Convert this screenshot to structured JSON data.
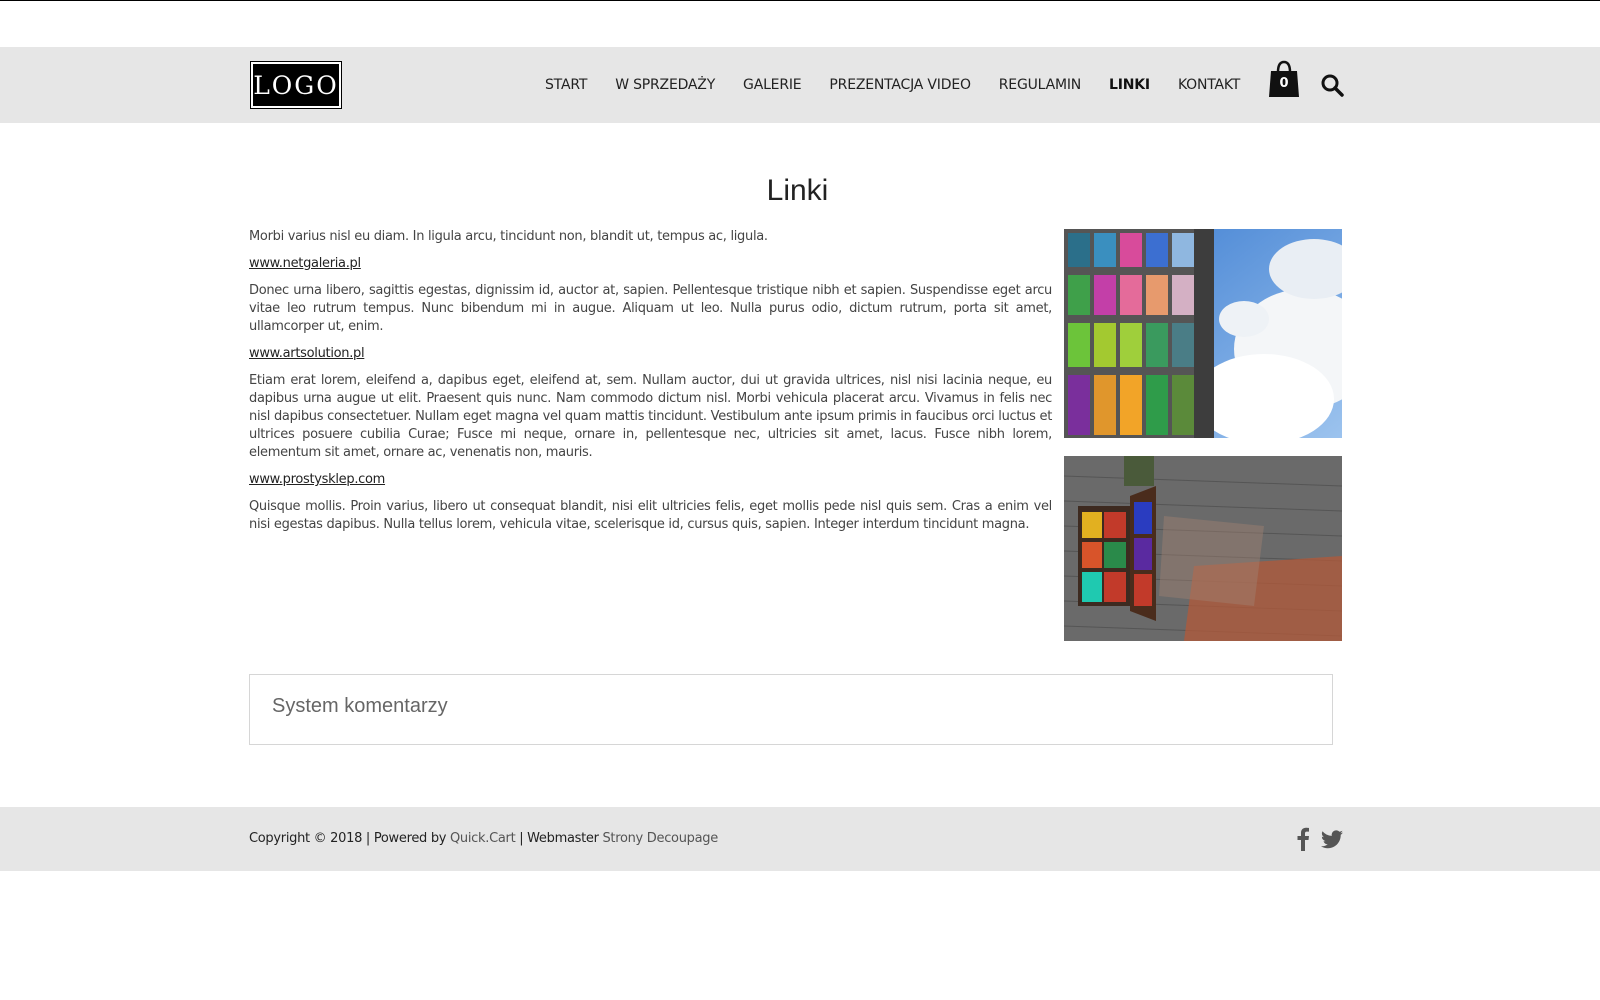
{
  "header": {
    "logo_text": "LOGO",
    "nav": [
      {
        "label": "START",
        "active": false
      },
      {
        "label": "W SPRZEDAŻY",
        "active": false
      },
      {
        "label": "GALERIE",
        "active": false
      },
      {
        "label": "PREZENTACJA VIDEO",
        "active": false
      },
      {
        "label": "REGULAMIN",
        "active": false
      },
      {
        "label": "LINKI",
        "active": true
      },
      {
        "label": "KONTAKT",
        "active": false
      }
    ],
    "cart_count": "0",
    "cart_icon": "shopping-bag-icon",
    "search_icon": "search-icon"
  },
  "page": {
    "title": "Linki",
    "paragraphs": [
      "Morbi varius nisl eu diam. In ligula arcu, tincidunt non, blandit ut, tempus ac, ligula.",
      "Donec urna libero, sagittis egestas, dignissim id, auctor at, sapien. Pellentesque tristique nibh et sapien. Suspendisse eget arcu vitae leo rutrum tempus. Nunc bibendum mi in augue. Aliquam ut leo. Nulla purus odio, dictum rutrum, porta sit amet, ullamcorper ut, enim.",
      "Etiam erat lorem, eleifend a, dapibus eget, eleifend at, sem. Nullam auctor, dui ut gravida ultrices, nisl nisi lacinia neque, eu dapibus urna augue ut elit. Praesent quis nunc. Nam commodo dictum nisl. Morbi vehicula placerat arcu. Vivamus in felis nec nisl dapibus consectetuer. Nullam eget magna vel quam mattis tincidunt. Vestibulum ante ipsum primis in faucibus orci luctus et ultrices posuere cubilia Curae; Fusce mi neque, ornare in, pellentesque nec, ultricies sit amet, lacus. Fusce nibh lorem, elementum sit amet, ornare ac, venenatis non, mauris.",
      "Quisque mollis. Proin varius, libero ut consequat blandit, nisi elit ultricies felis, eget mollis pede nisl quis sem. Cras a enim vel nisi egestas dapibus. Nulla tellus lorem, vehicula vitae, scelerisque id, cursus quis, sapien. Integer interdum tincidunt magna."
    ],
    "links": [
      "www.netgaleria.pl",
      "www.artsolution.pl",
      "www.prostysklep.com"
    ]
  },
  "comments": {
    "title": "System komentarzy"
  },
  "footer": {
    "copyright": "Copyright © 2018 | Powered by ",
    "powered_link": "Quick.Cart",
    "separator": " | Webmaster ",
    "webmaster_link": "Strony Decoupage",
    "social_icons": [
      "facebook-icon",
      "twitter-icon"
    ]
  },
  "colors": {
    "header_bg": "#e6e6e6",
    "footer_bg": "#e6e6e6",
    "text": "#444444"
  }
}
